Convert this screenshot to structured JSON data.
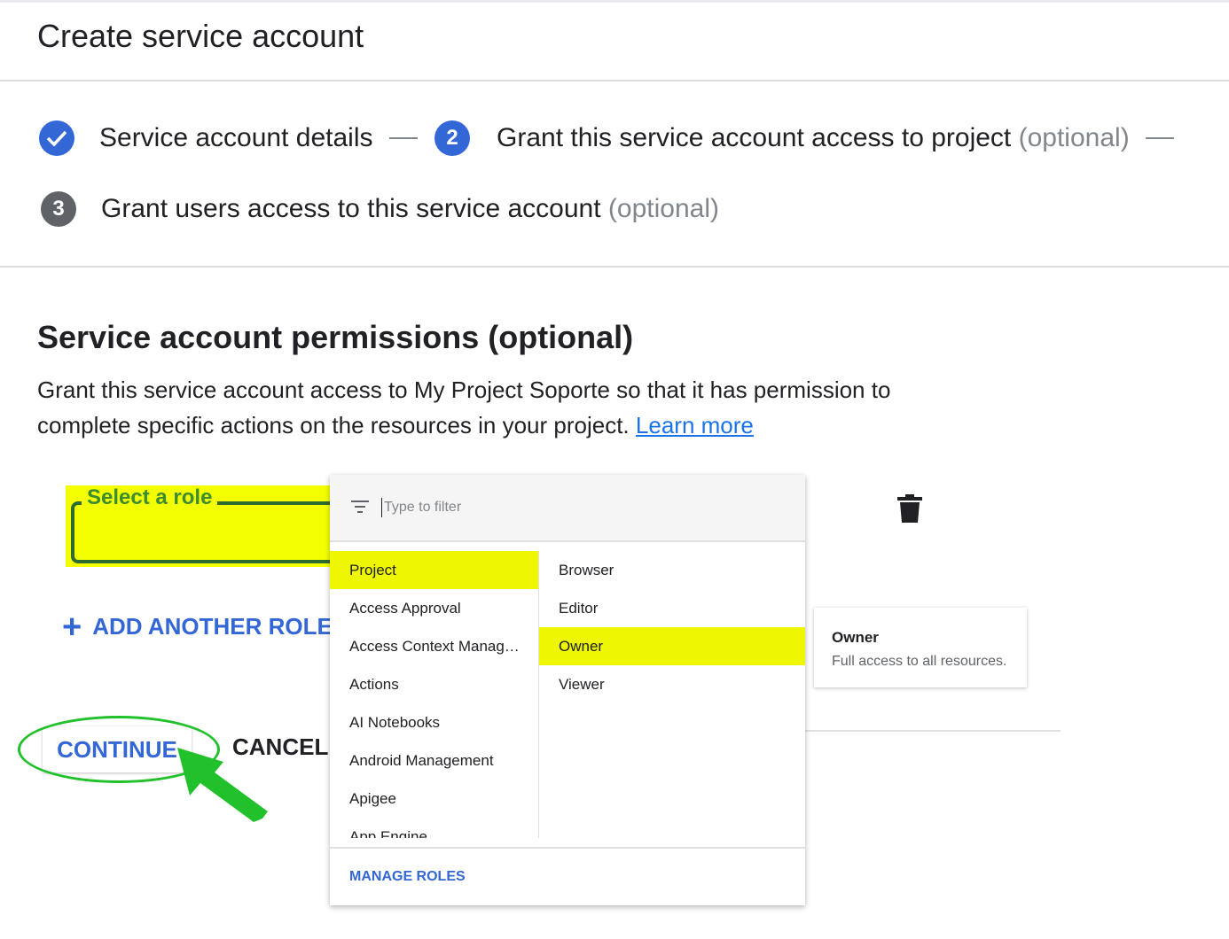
{
  "header": {
    "title": "Create service account"
  },
  "stepper": {
    "steps": [
      {
        "number": "✓",
        "label": "Service account details",
        "optional": ""
      },
      {
        "number": "2",
        "label": "Grant this service account access to project",
        "optional": "(optional)"
      },
      {
        "number": "3",
        "label": "Grant users access to this service account",
        "optional": "(optional)"
      }
    ]
  },
  "permissions": {
    "title": "Service account permissions (optional)",
    "description": "Grant this service account access to My Project Soporte so that it has permission to complete specific actions on the resources in your project.",
    "learn_more": "Learn more"
  },
  "role_field": {
    "label": "Select a role"
  },
  "add_role": {
    "label": "ADD ANOTHER ROLE"
  },
  "actions": {
    "continue_label": "CONTINUE",
    "cancel_label": "CANCEL"
  },
  "dropdown": {
    "filter_placeholder": "Type to filter",
    "categories": [
      "Project",
      "Access Approval",
      "Access Context Manag…",
      "Actions",
      "AI Notebooks",
      "Android Management",
      "Apigee",
      "App Engine"
    ],
    "selected_category": "Project",
    "roles": [
      "Browser",
      "Editor",
      "Owner",
      "Viewer"
    ],
    "selected_role": "Owner",
    "manage_roles": "MANAGE ROLES"
  },
  "tooltip": {
    "title": "Owner",
    "description": "Full access to all resources."
  },
  "colors": {
    "accent": "#3367d6",
    "highlight": "#f3ff00",
    "annotation_green": "#21c12b"
  }
}
